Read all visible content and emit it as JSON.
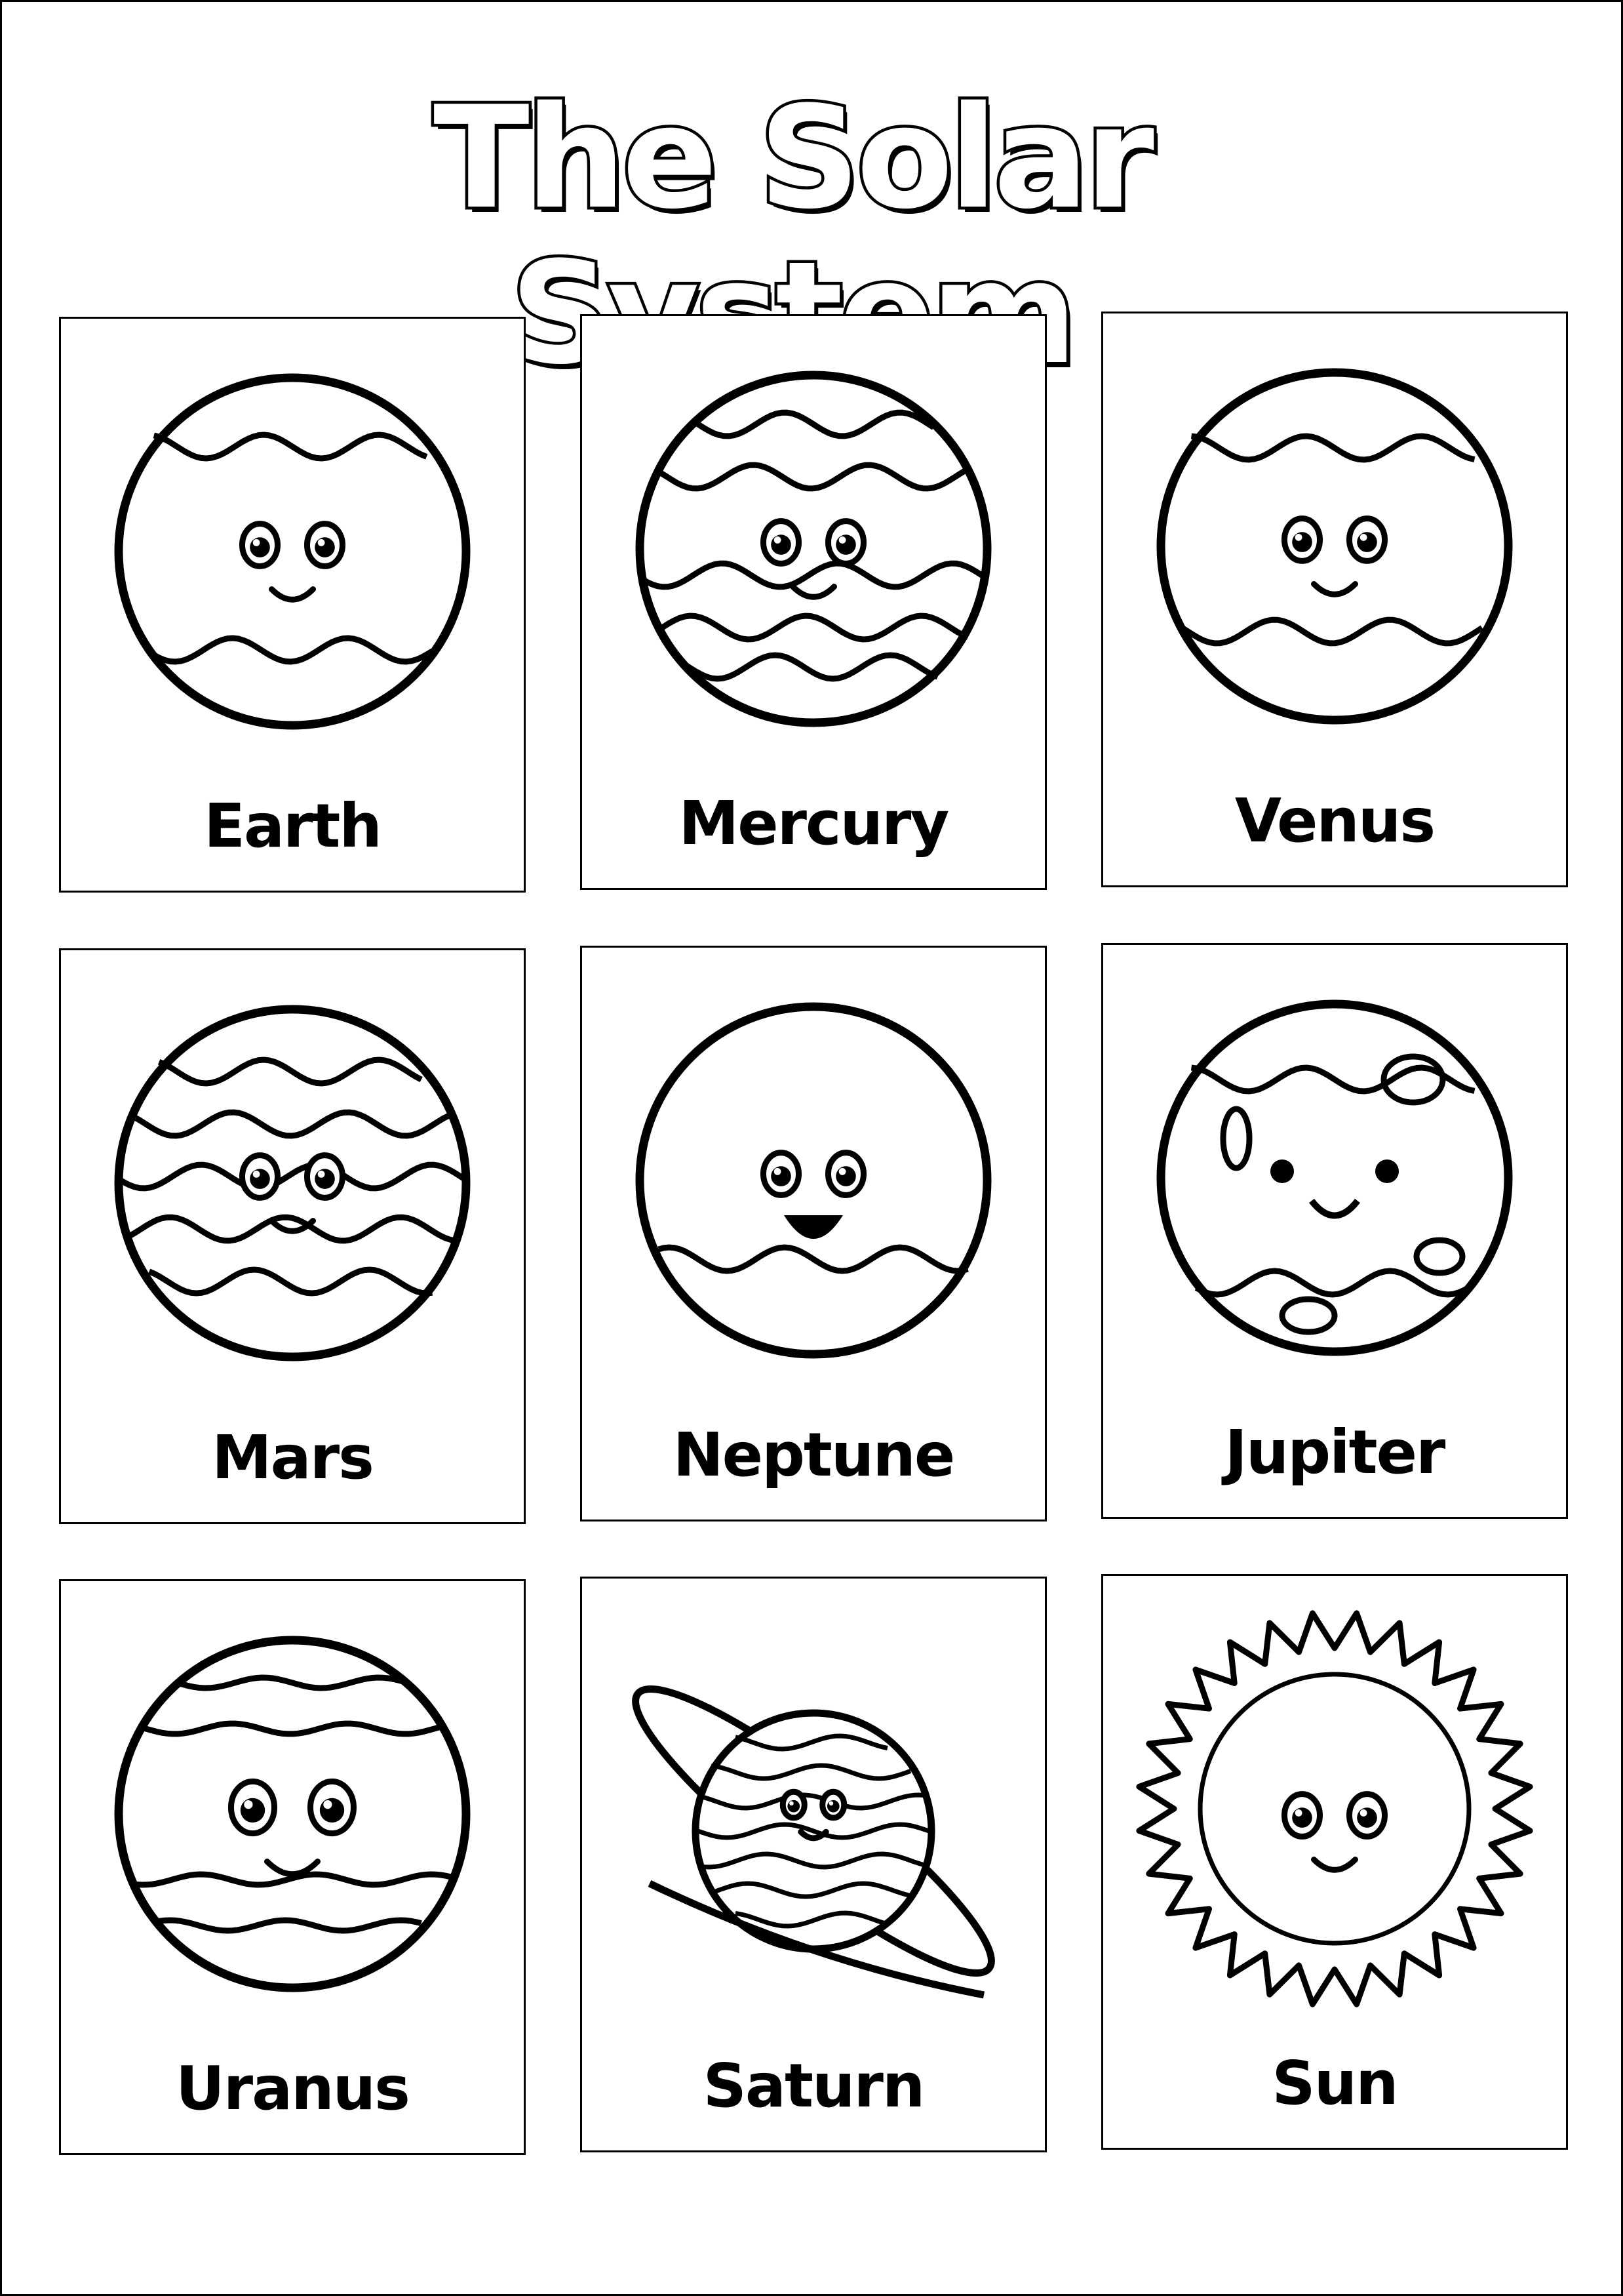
{
  "title": "The Solar System",
  "cards": [
    {
      "label": "Earth",
      "art": "earth"
    },
    {
      "label": "Mercury",
      "art": "mercury"
    },
    {
      "label": "Venus",
      "art": "venus"
    },
    {
      "label": "Mars",
      "art": "mars"
    },
    {
      "label": "Neptune",
      "art": "neptune"
    },
    {
      "label": "Jupiter",
      "art": "jupiter"
    },
    {
      "label": "Uranus",
      "art": "uranus"
    },
    {
      "label": "Saturn",
      "art": "saturn"
    },
    {
      "label": "Sun",
      "art": "sun"
    }
  ],
  "line_color": "#000000",
  "background_color": "#ffffff"
}
